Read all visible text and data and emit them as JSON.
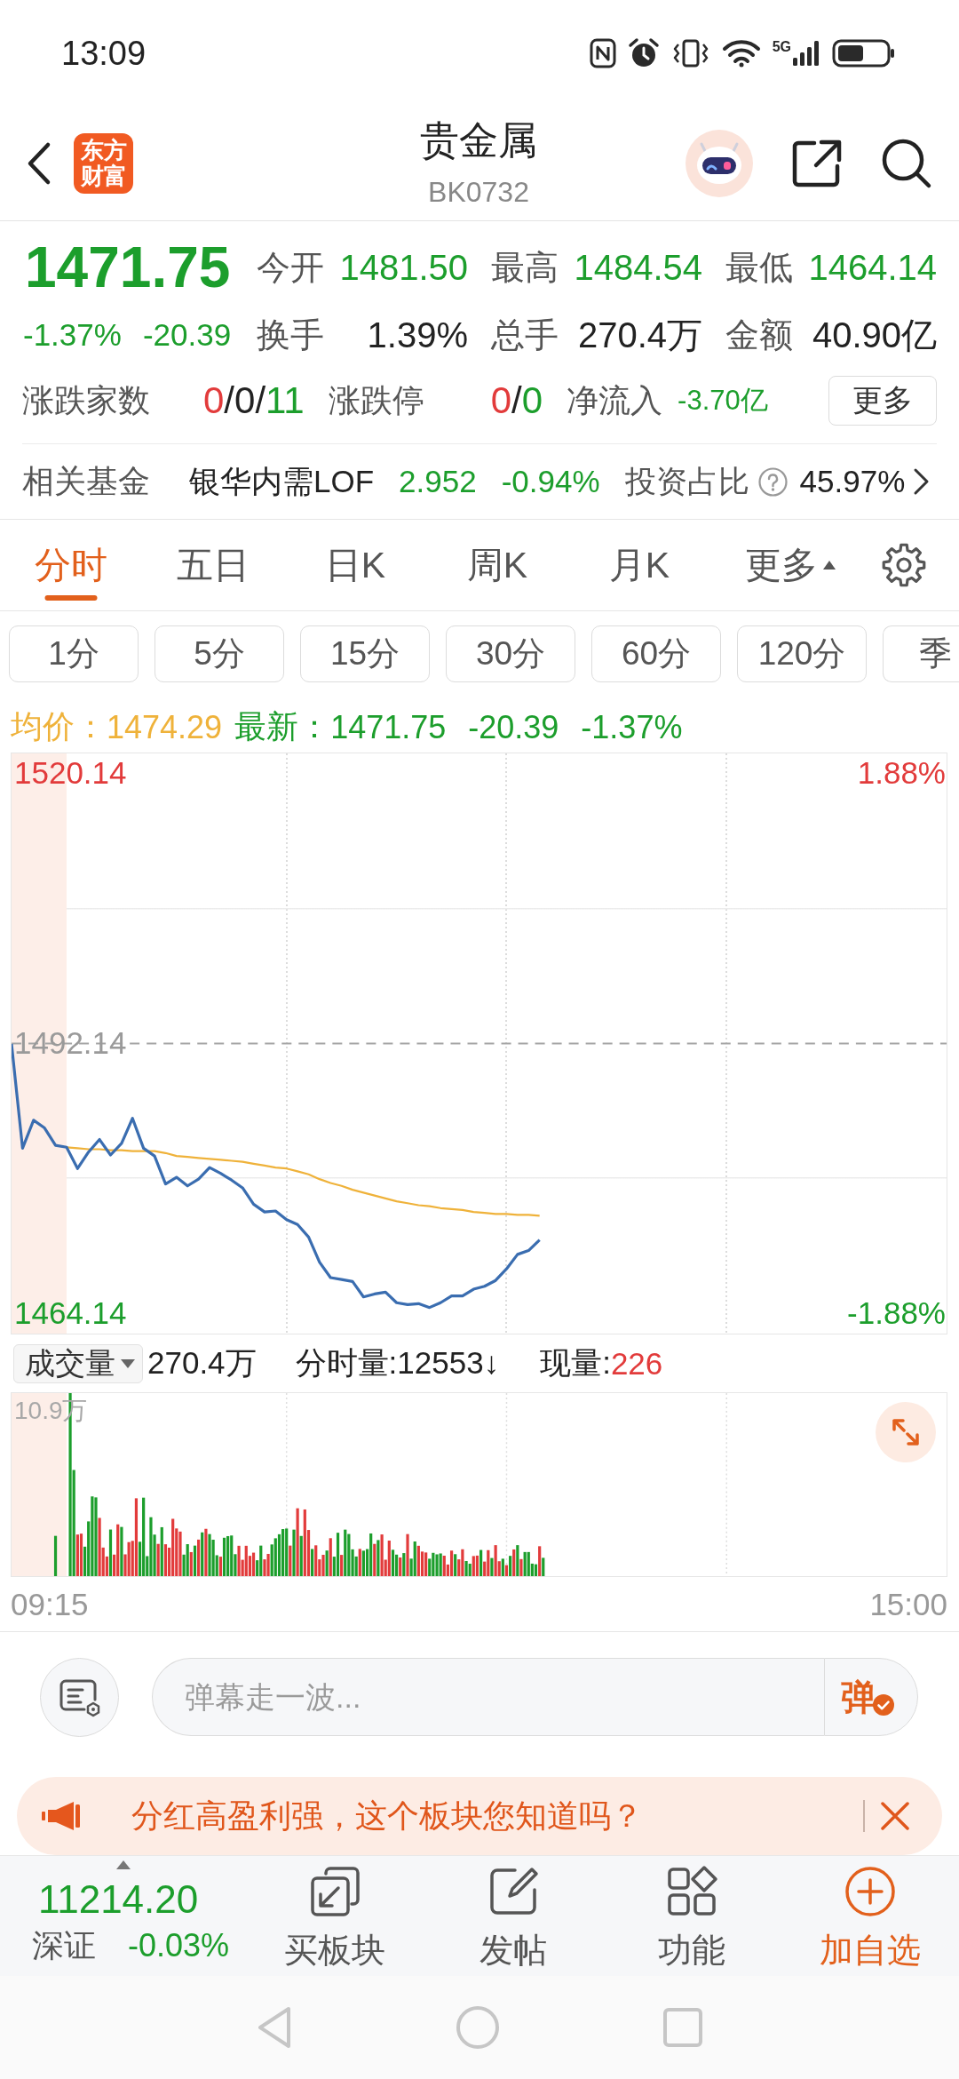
{
  "status_bar": {
    "time": "13:09",
    "network": "5G"
  },
  "header": {
    "logo": "东方财富",
    "title": "贵金属",
    "code": "BK0732"
  },
  "quote": {
    "price": {
      "value": "1471.75",
      "percent": "-1.37%",
      "change": "-20.39",
      "color": "#1c9e2c"
    },
    "stats": [
      {
        "label": "今开",
        "value": "1481.50",
        "color": "#1c9e2c"
      },
      {
        "label": "最高",
        "value": "1484.54",
        "color": "#1c9e2c"
      },
      {
        "label": "最低",
        "value": "1464.14",
        "color": "#1c9e2c"
      },
      {
        "label": "换手",
        "value": "1.39%",
        "color": "#222222"
      },
      {
        "label": "总手",
        "value": "270.4万",
        "color": "#222222"
      },
      {
        "label": "金额",
        "value": "40.90亿",
        "color": "#222222"
      }
    ],
    "counts": [
      {
        "label": "涨跌家数",
        "parts": [
          {
            "text": "0",
            "color": "#e23b3b"
          },
          {
            "text": "/0/",
            "color": "#222222"
          },
          {
            "text": "11",
            "color": "#1c9e2c"
          }
        ]
      },
      {
        "label": "涨跌停",
        "parts": [
          {
            "text": "0",
            "color": "#e23b3b"
          },
          {
            "text": "/",
            "color": "#222222"
          },
          {
            "text": "0",
            "color": "#1c9e2c"
          }
        ]
      },
      {
        "label": "净流入",
        "parts": [
          {
            "text": "-3.70亿",
            "color": "#1c9e2c"
          }
        ]
      }
    ],
    "more_button": "更多",
    "fund": {
      "label": "相关基金",
      "name": "银华内需LOF",
      "price": "2.952",
      "change": "-0.94%",
      "color": "#1c9e2c",
      "ratio_label": "投资占比",
      "ratio": "45.97%"
    }
  },
  "tabs": [
    {
      "label": "分时",
      "selected": true,
      "kind": "tab"
    },
    {
      "label": "五日",
      "selected": false,
      "kind": "tab"
    },
    {
      "label": "日K",
      "selected": false,
      "kind": "tab"
    },
    {
      "label": "周K",
      "selected": false,
      "kind": "tab"
    },
    {
      "label": "月K",
      "selected": false,
      "kind": "tab"
    },
    {
      "label": "更多",
      "selected": false,
      "kind": "menu"
    }
  ],
  "periods": [
    {
      "label": "1分",
      "selected": false
    },
    {
      "label": "5分",
      "selected": false
    },
    {
      "label": "15分",
      "selected": false
    },
    {
      "label": "30分",
      "selected": false
    },
    {
      "label": "60分",
      "selected": false
    },
    {
      "label": "120分",
      "selected": false
    },
    {
      "label": "季",
      "selected": false
    }
  ],
  "intraday": {
    "summary": [
      {
        "label": "均价：",
        "value": "1474.29",
        "color": "#efb23a"
      },
      {
        "label": "最新：",
        "value": "1471.75",
        "change": "-20.39",
        "percent": "-1.37%",
        "color": "#1c9e2c"
      }
    ],
    "right_axis": [
      "1.88%",
      "-1.88%"
    ],
    "chart_data": {
      "type": "line",
      "ylim": [
        1462.1,
        1522.2
      ],
      "yticks": [
        {
          "value": 1464.14,
          "label": "1464.14"
        },
        {
          "value": 1492.14,
          "label": "1492.14"
        },
        {
          "value": 1520.14,
          "label": "1520.14"
        }
      ],
      "ref_lines": [
        {
          "axis": "y",
          "value": 1492.14
        }
      ],
      "categories": [
        null,
        null,
        null,
        null,
        null,
        null,
        null,
        null,
        null,
        null,
        null,
        null,
        null,
        null,
        null,
        null,
        null,
        null,
        null,
        null,
        null,
        null,
        null,
        null,
        null,
        null,
        null,
        null,
        null,
        null,
        null,
        null,
        null,
        null,
        null,
        null,
        null,
        null,
        null,
        null,
        null,
        null,
        null,
        null,
        null,
        null,
        null,
        null,
        null,
        null,
        null,
        null,
        null,
        null,
        null,
        null,
        null,
        null,
        null,
        null,
        null,
        null,
        null,
        null,
        null,
        null,
        null,
        null,
        null,
        null,
        null,
        null,
        null,
        null,
        null,
        null,
        null,
        null,
        null,
        null,
        null,
        null,
        null,
        null,
        null,
        null
      ],
      "series": [
        {
          "color": "#3a6db0",
          "values": [
            1492.1,
            1481.3,
            1484.2,
            1483.4,
            1481.6,
            1481.4,
            1479.2,
            1480.9,
            1482.2,
            1480.6,
            1481.8,
            1484.4,
            1481.3,
            1480.5,
            1477.6,
            1478.3,
            1477.4,
            1478.1,
            1479.3,
            1478.7,
            1478.0,
            1477.2,
            1475.5,
            1474.7,
            1474.8,
            1473.9,
            1473.4,
            1472.1,
            1469.5,
            1467.9,
            1467.7,
            1467.5,
            1465.9,
            1466.2,
            1466.4,
            1465.3,
            1465.1,
            1465.2,
            1464.8,
            1465.3,
            1466.0,
            1466.0,
            1466.7,
            1467.0,
            1467.6,
            1468.8,
            1470.3,
            1470.7,
            1471.8,
            null,
            null,
            null,
            null,
            null,
            null,
            null,
            null,
            null,
            null,
            null,
            null,
            null,
            null,
            null,
            null,
            null,
            null,
            null,
            null,
            null,
            null,
            null,
            null,
            null,
            null,
            null,
            null,
            null,
            null,
            null,
            null,
            null,
            null,
            null,
            null,
            null
          ]
        },
        {
          "color": "#efb23a",
          "values": [
            null,
            null,
            null,
            null,
            null,
            1481.4,
            1481.3,
            1481.2,
            1481.2,
            1481.1,
            1481.1,
            1481.0,
            1481.0,
            1481.0,
            1480.8,
            1480.5,
            1480.4,
            1480.3,
            1480.2,
            1480.1,
            1480.0,
            1479.9,
            1479.7,
            1479.5,
            1479.3,
            1479.2,
            1478.9,
            1478.6,
            1478.1,
            1477.7,
            1477.4,
            1477.0,
            1476.7,
            1476.4,
            1476.1,
            1475.8,
            1475.6,
            1475.4,
            1475.3,
            1475.1,
            1475.0,
            1474.9,
            1474.7,
            1474.6,
            1474.5,
            1474.5,
            1474.4,
            1474.4,
            1474.3,
            null,
            null,
            null,
            null,
            null,
            null,
            null,
            null,
            null,
            null,
            null,
            null,
            null,
            null,
            null,
            null,
            null,
            null,
            null,
            null,
            null,
            null,
            null,
            null,
            null,
            null,
            null,
            null,
            null,
            null,
            null,
            null,
            null,
            null,
            null,
            null,
            null
          ]
        }
      ]
    },
    "time_axis": [
      "09:15",
      "15:00"
    ]
  },
  "volume": {
    "selector": "成交量",
    "total": "270.4万",
    "minute": "分时量:12553↓",
    "current": {
      "label": "现量:",
      "value": "226",
      "color": "#e23b3b"
    },
    "max_label": "10.9万"
  },
  "danmaku": {
    "placeholder": "弹幕走一波...",
    "send_label": "弹"
  },
  "notice": {
    "text": "分红高盈利强，这个板块您知道吗？"
  },
  "toolbar": {
    "index": {
      "value": "11214.20",
      "name": "深证",
      "change": "-0.03%",
      "color": "#1c9e2c"
    },
    "items": [
      {
        "label": "买板块",
        "kind": "buy"
      },
      {
        "label": "发帖",
        "kind": "post"
      },
      {
        "label": "功能",
        "kind": "tools"
      },
      {
        "label": "加自选",
        "kind": "watchlist"
      }
    ]
  }
}
